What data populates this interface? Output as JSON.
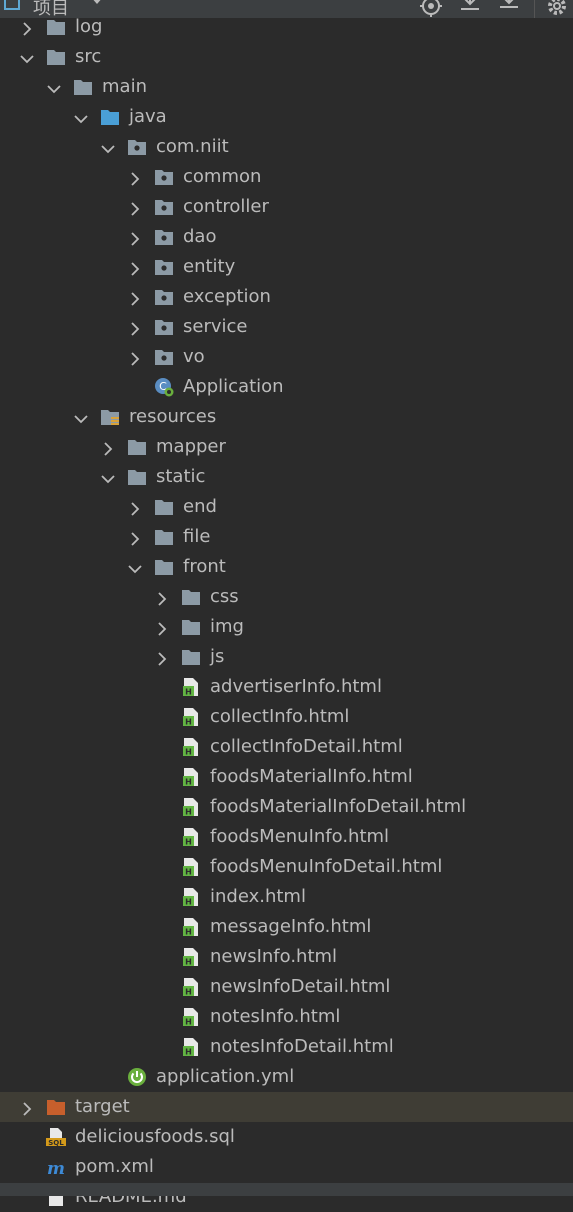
{
  "header": {
    "title": "项目"
  },
  "tree": [
    {
      "label": "log",
      "depth": 0,
      "chevron": "right",
      "icon": "folder"
    },
    {
      "label": "src",
      "depth": 0,
      "chevron": "down",
      "icon": "folder"
    },
    {
      "label": "main",
      "depth": 1,
      "chevron": "down",
      "icon": "folder"
    },
    {
      "label": "java",
      "depth": 2,
      "chevron": "down",
      "icon": "folder-blue"
    },
    {
      "label": "com.niit",
      "depth": 3,
      "chevron": "down",
      "icon": "package"
    },
    {
      "label": "common",
      "depth": 4,
      "chevron": "right",
      "icon": "package"
    },
    {
      "label": "controller",
      "depth": 4,
      "chevron": "right",
      "icon": "package"
    },
    {
      "label": "dao",
      "depth": 4,
      "chevron": "right",
      "icon": "package"
    },
    {
      "label": "entity",
      "depth": 4,
      "chevron": "right",
      "icon": "package"
    },
    {
      "label": "exception",
      "depth": 4,
      "chevron": "right",
      "icon": "package"
    },
    {
      "label": "service",
      "depth": 4,
      "chevron": "right",
      "icon": "package"
    },
    {
      "label": "vo",
      "depth": 4,
      "chevron": "right",
      "icon": "package"
    },
    {
      "label": "Application",
      "depth": 4,
      "chevron": "none",
      "icon": "spring-class"
    },
    {
      "label": "resources",
      "depth": 2,
      "chevron": "down",
      "icon": "resources-folder"
    },
    {
      "label": "mapper",
      "depth": 3,
      "chevron": "right",
      "icon": "folder"
    },
    {
      "label": "static",
      "depth": 3,
      "chevron": "down",
      "icon": "folder"
    },
    {
      "label": "end",
      "depth": 4,
      "chevron": "right",
      "icon": "folder"
    },
    {
      "label": "file",
      "depth": 4,
      "chevron": "right",
      "icon": "folder"
    },
    {
      "label": "front",
      "depth": 4,
      "chevron": "down",
      "icon": "folder"
    },
    {
      "label": "css",
      "depth": 5,
      "chevron": "right",
      "icon": "folder"
    },
    {
      "label": "img",
      "depth": 5,
      "chevron": "right",
      "icon": "folder"
    },
    {
      "label": "js",
      "depth": 5,
      "chevron": "right",
      "icon": "folder"
    },
    {
      "label": "advertiserInfo.html",
      "depth": 5,
      "chevron": "none",
      "icon": "html-file"
    },
    {
      "label": "collectInfo.html",
      "depth": 5,
      "chevron": "none",
      "icon": "html-file"
    },
    {
      "label": "collectInfoDetail.html",
      "depth": 5,
      "chevron": "none",
      "icon": "html-file"
    },
    {
      "label": "foodsMaterialInfo.html",
      "depth": 5,
      "chevron": "none",
      "icon": "html-file"
    },
    {
      "label": "foodsMaterialInfoDetail.html",
      "depth": 5,
      "chevron": "none",
      "icon": "html-file"
    },
    {
      "label": "foodsMenuInfo.html",
      "depth": 5,
      "chevron": "none",
      "icon": "html-file"
    },
    {
      "label": "foodsMenuInfoDetail.html",
      "depth": 5,
      "chevron": "none",
      "icon": "html-file"
    },
    {
      "label": "index.html",
      "depth": 5,
      "chevron": "none",
      "icon": "html-file"
    },
    {
      "label": "messageInfo.html",
      "depth": 5,
      "chevron": "none",
      "icon": "html-file"
    },
    {
      "label": "newsInfo.html",
      "depth": 5,
      "chevron": "none",
      "icon": "html-file"
    },
    {
      "label": "newsInfoDetail.html",
      "depth": 5,
      "chevron": "none",
      "icon": "html-file"
    },
    {
      "label": "notesInfo.html",
      "depth": 5,
      "chevron": "none",
      "icon": "html-file"
    },
    {
      "label": "notesInfoDetail.html",
      "depth": 5,
      "chevron": "none",
      "icon": "html-file"
    },
    {
      "label": "application.yml",
      "depth": 3,
      "chevron": "none",
      "icon": "spring-config"
    },
    {
      "label": "target",
      "depth": 0,
      "chevron": "right",
      "icon": "folder-orange",
      "excluded": true
    },
    {
      "label": "deliciousfoods.sql",
      "depth": 0,
      "chevron": "none",
      "icon": "sql-file"
    },
    {
      "label": "pom.xml",
      "depth": 0,
      "chevron": "none",
      "icon": "maven-file"
    },
    {
      "label": "README.md",
      "depth": 0,
      "chevron": "none",
      "icon": "markdown-file"
    }
  ],
  "colors": {
    "background": "#2b2b2b",
    "text": "#bbbbbb",
    "folder": "#8c9aa5",
    "blue-folder": "#4a9fd6",
    "html": "#62b543",
    "spring": "#6aaf3d",
    "orange": "#c75f2c",
    "sql": "#d49a1a",
    "maven": "#3d8ad6"
  }
}
